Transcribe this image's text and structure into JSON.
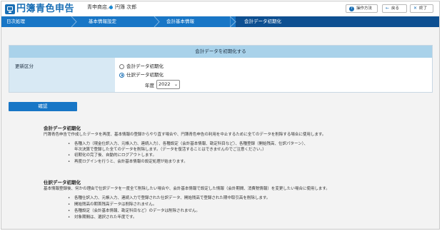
{
  "header": {
    "app_title": "円簿青色申告",
    "shop": "青申商店／",
    "user": "円簿 次郎",
    "help_label": "操作方法",
    "back_label": "戻る",
    "close_label": "終了"
  },
  "steps": [
    "日次処理",
    "基本情報設定",
    "会計基本情報",
    "会計データ初期化"
  ],
  "panel": {
    "title": "会計データを初期化する",
    "field_label": "更新区分",
    "options": [
      "会計データ初期化",
      "仕訳データ初期化"
    ],
    "selected_option": "仕訳データ初期化",
    "year_label": "年度",
    "year_value": "2022"
  },
  "confirm_label": "確認",
  "sections": [
    {
      "title": "会計データ初期化",
      "intro": "円簿青色申告で作成したデータを再度、基本情報の登録からやり直す場合や、円簿青色申告の利用を中止するために全てのデータを削除する場合に使用します。",
      "bullets": [
        "各種入力（現金仕訳入力、元帳入力、連続入力）、各種設定（会計基本情報、勘定科目など）、各種登録（開始残高、仕訳パターン）、",
        "年次決算で登録した全てのデータを削除します。（データを復活することはできませんのでご注意ください。）",
        "初期化の完了後、自動的にログアウトします。",
        "再度ログインを行うと、会計基本情報の設定処理が始まります。"
      ]
    },
    {
      "title": "仕訳データ初期化",
      "intro": "基本情報登録後、何かの理由で仕訳データを一度全て削除したい場合や、会計基本情報で設定した情報（会計期間、消費税情報）を変更したい場合に使用します。",
      "bullets": [
        "各種仕訳入力、元帳入力、連続入力で登録された仕訳データ、開始残高で登録された期中取引高を削除します。",
        "開始残高の期首残高データは削除されません。",
        "各種設定（会計基本情報、勘定科目など）のデータは削除されません。",
        "対象期間は、選択された年度です。"
      ]
    }
  ],
  "colors": {
    "brand": "#1a6fb5",
    "nav": "#1876c6",
    "nav_active": "#0d4f91",
    "panel_header": "#a9d2ea",
    "label_cell": "#d8e9f4"
  }
}
